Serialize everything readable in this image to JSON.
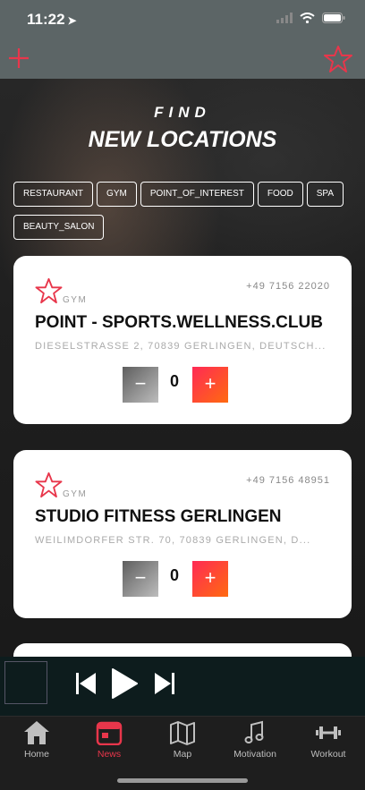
{
  "status_bar": {
    "time": "11:22"
  },
  "header": {
    "add_icon": "plus-icon",
    "favorites_icon": "star-icon"
  },
  "hero": {
    "small_title": "FIND",
    "big_title": "NEW LOCATIONS"
  },
  "filters": [
    "RESTAURANT",
    "GYM",
    "POINT_OF_INTEREST",
    "FOOD",
    "SPA",
    "BEAUTY_SALON"
  ],
  "locations": [
    {
      "type": "GYM",
      "phone": "+49 7156 22020",
      "name": "POINT - SPORTS.WELLNESS.CLUB",
      "address": "DIESELSTRASSE 2, 70839 GERLINGEN, DEUTSCH...",
      "minus": "−",
      "quantity": "0",
      "plus": "+"
    },
    {
      "type": "GYM",
      "phone": "+49 7156 48951",
      "name": "STUDIO FITNESS GERLINGEN",
      "address": "WEILIMDORFER STR. 70, 70839 GERLINGEN, D...",
      "minus": "−",
      "quantity": "0",
      "plus": "+"
    }
  ],
  "player": {
    "prev_icon": "skip-previous-icon",
    "play_icon": "play-icon",
    "next_icon": "skip-next-icon"
  },
  "tabs": [
    {
      "label": "Home",
      "icon": "home-icon",
      "active": false
    },
    {
      "label": "News",
      "icon": "calendar-icon",
      "active": true
    },
    {
      "label": "Map",
      "icon": "map-icon",
      "active": false
    },
    {
      "label": "Motivation",
      "icon": "music-note-icon",
      "active": false
    },
    {
      "label": "Workout",
      "icon": "dumbbell-icon",
      "active": false
    }
  ],
  "colors": {
    "accent": "#e8364b",
    "header": "#5c6566",
    "player": "#0d1c1d",
    "tabbar": "#1e1e1e"
  }
}
